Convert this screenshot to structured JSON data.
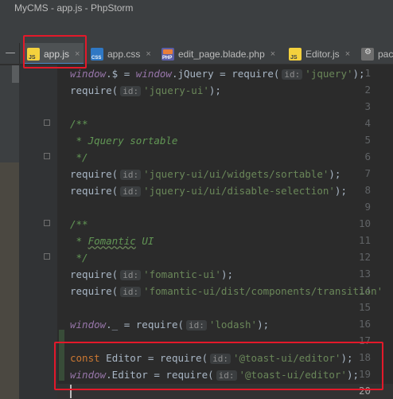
{
  "window": {
    "title": "MyCMS - app.js - PhpStorm"
  },
  "toolbar": {
    "collapse_label": "—"
  },
  "tabs": [
    {
      "label": "app.js",
      "icon": "js",
      "close": "×"
    },
    {
      "label": "app.css",
      "icon": "css",
      "close": "×"
    },
    {
      "label": "edit_page.blade.php",
      "icon": "php",
      "close": "×"
    },
    {
      "label": "Editor.js",
      "icon": "js",
      "close": "×"
    },
    {
      "label": "pack",
      "icon": "pkg",
      "close": ""
    }
  ],
  "icons": {
    "js": "JS",
    "css": "CSS",
    "php": "PHP",
    "pkg": "⚙"
  },
  "hint": "id:",
  "lines": [
    {
      "n": "1",
      "parts": [
        "window",
        ".$ = ",
        "window",
        ".jQuery = require(",
        "'jquery'",
        ");"
      ]
    },
    {
      "n": "2",
      "parts": [
        "require(",
        "'jquery-ui'",
        ");"
      ]
    },
    {
      "n": "3"
    },
    {
      "n": "4",
      "parts": [
        "/**"
      ]
    },
    {
      "n": "5",
      "parts": [
        " * Jquery sortable"
      ]
    },
    {
      "n": "6",
      "parts": [
        " */"
      ]
    },
    {
      "n": "7",
      "parts": [
        "require(",
        "'jquery-ui/ui/widgets/sortable'",
        ");"
      ]
    },
    {
      "n": "8",
      "parts": [
        "require(",
        "'jquery-ui/ui/disable-selection'",
        ");"
      ]
    },
    {
      "n": "9"
    },
    {
      "n": "10",
      "parts": [
        "/**"
      ]
    },
    {
      "n": "11",
      "parts": [
        " * ",
        "Fomantic",
        " UI"
      ]
    },
    {
      "n": "12",
      "parts": [
        " */"
      ]
    },
    {
      "n": "13",
      "parts": [
        "require(",
        "'fomantic-ui'",
        ");"
      ]
    },
    {
      "n": "14",
      "parts": [
        "require(",
        "'fomantic-ui/dist/components/transition'"
      ]
    },
    {
      "n": "15"
    },
    {
      "n": "16",
      "parts": [
        "window",
        "._ = require(",
        "'lodash'",
        ");"
      ]
    },
    {
      "n": "17"
    },
    {
      "n": "18",
      "parts": [
        "const",
        " Editor = require(",
        "'@toast-ui/editor'",
        ");"
      ]
    },
    {
      "n": "19",
      "parts": [
        "window",
        ".Editor = require(",
        "'@toast-ui/editor'",
        ");"
      ]
    },
    {
      "n": "20"
    }
  ]
}
